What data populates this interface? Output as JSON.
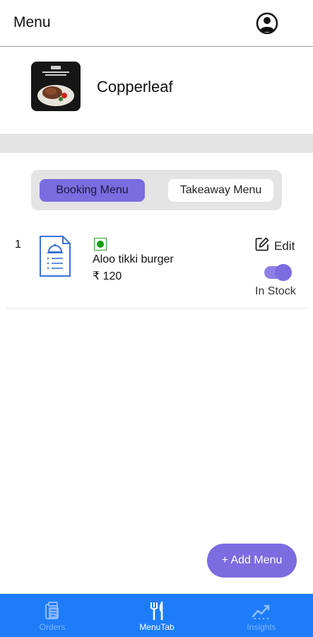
{
  "header": {
    "title": "Menu",
    "profile_icon": "account-circle-icon"
  },
  "restaurant": {
    "name": "Copperleaf",
    "logo_icon": "restaurant-logo-image"
  },
  "tabs": [
    {
      "label": "Booking Menu",
      "active": true
    },
    {
      "label": "Takeaway Menu",
      "active": false
    }
  ],
  "items": [
    {
      "index": "1",
      "name": "Aloo tikki burger",
      "price": "₹ 120",
      "edit_label": "Edit",
      "stock_label": "In Stock",
      "in_stock": true,
      "veg_icon": "veg-indicator-icon"
    }
  ],
  "add_menu": {
    "label": "+ Add Menu"
  },
  "nav": [
    {
      "label": "Orders",
      "icon": "clipboard-icon",
      "active": false
    },
    {
      "label": "MenuTab",
      "icon": "fork-knife-icon",
      "active": true
    },
    {
      "label": "Insights",
      "icon": "trend-chart-icon",
      "active": false
    }
  ],
  "colors": {
    "accent": "#7b6ce0",
    "nav_bg": "#1e7cf9",
    "veg_green": "#119d11",
    "divider": "#e3e3e3"
  }
}
